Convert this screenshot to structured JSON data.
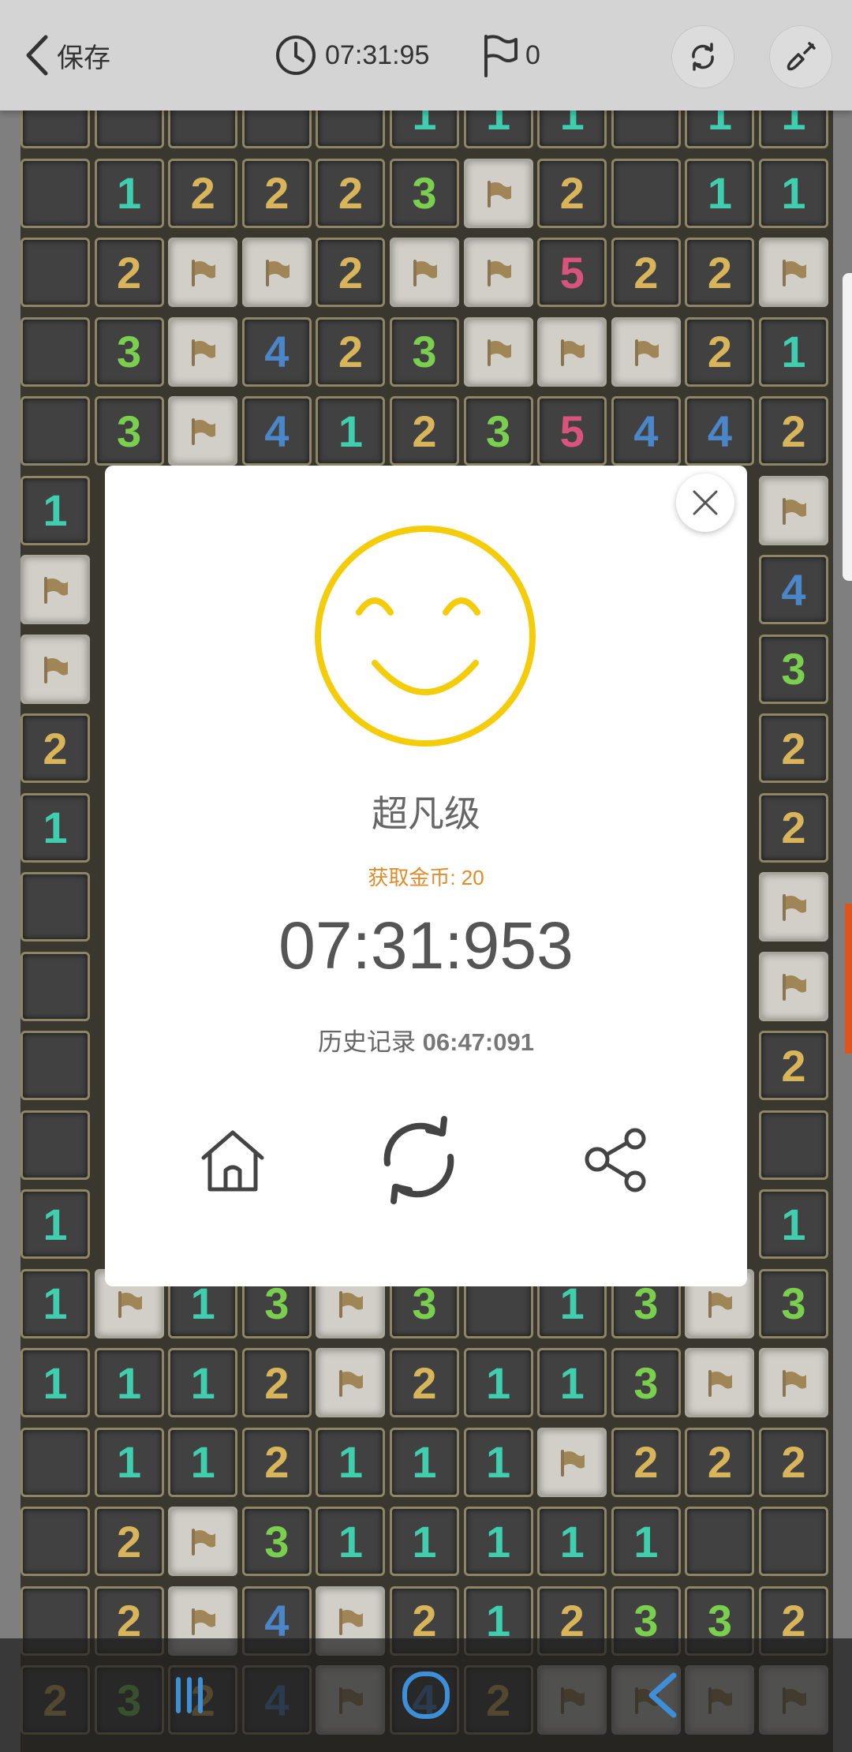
{
  "header": {
    "back_label": "保存",
    "timer": "07:31:95",
    "flag_count": "0"
  },
  "board": {
    "rows": [
      [
        "o",
        "o",
        "o",
        "o",
        "o",
        "1",
        "1",
        "1",
        "o",
        "1",
        "1"
      ],
      [
        "o",
        "1",
        "2",
        "2",
        "2",
        "3",
        "F",
        "2",
        "o",
        "1",
        "1"
      ],
      [
        "o",
        "2",
        "F",
        "F",
        "2",
        "F",
        "F",
        "5",
        "2",
        "2",
        "F"
      ],
      [
        "o",
        "3",
        "F",
        "4",
        "2",
        "3",
        "F",
        "F",
        "F",
        "2",
        "1"
      ],
      [
        "o",
        "3",
        "F",
        "4",
        "1",
        "2",
        "3",
        "5",
        "4",
        "4",
        "2"
      ],
      [
        "1",
        "",
        "",
        "",
        "",
        "",
        "",
        "",
        "",
        "",
        "F"
      ],
      [
        "F",
        "",
        "",
        "",
        "",
        "",
        "",
        "",
        "",
        "",
        "4"
      ],
      [
        "F",
        "",
        "",
        "",
        "",
        "",
        "",
        "",
        "",
        "",
        "3"
      ],
      [
        "2",
        "",
        "",
        "",
        "",
        "",
        "",
        "",
        "",
        "",
        "2"
      ],
      [
        "1",
        "",
        "",
        "",
        "",
        "",
        "",
        "",
        "",
        "",
        "2"
      ],
      [
        "o",
        "",
        "",
        "",
        "",
        "",
        "",
        "",
        "",
        "",
        "F"
      ],
      [
        "o",
        "",
        "",
        "",
        "",
        "",
        "",
        "",
        "",
        "",
        "F"
      ],
      [
        "o",
        "",
        "",
        "",
        "",
        "",
        "",
        "",
        "",
        "",
        "2"
      ],
      [
        "o",
        "",
        "",
        "",
        "",
        "",
        "",
        "",
        "",
        "",
        "o"
      ],
      [
        "1",
        "",
        "",
        "",
        "",
        "",
        "",
        "",
        "",
        "",
        "1"
      ],
      [
        "1",
        "F",
        "1",
        "3",
        "F",
        "3",
        "o",
        "1",
        "3",
        "F",
        "3"
      ],
      [
        "1",
        "1",
        "1",
        "2",
        "F",
        "2",
        "1",
        "1",
        "3",
        "F",
        "F"
      ],
      [
        "o",
        "1",
        "1",
        "2",
        "1",
        "1",
        "1",
        "F",
        "2",
        "2",
        "2"
      ],
      [
        "o",
        "2",
        "F",
        "3",
        "1",
        "1",
        "1",
        "1",
        "1",
        "o",
        "o"
      ],
      [
        "o",
        "2",
        "F",
        "4",
        "F",
        "2",
        "1",
        "2",
        "3",
        "3",
        "2"
      ],
      [
        "2",
        "3",
        "2",
        "4",
        "F",
        "4",
        "2",
        "F",
        "F",
        "F",
        "F"
      ]
    ]
  },
  "dialog": {
    "rank": "超凡级",
    "coins": "获取金币: 20",
    "time": "07:31:953",
    "record_label": "历史记录",
    "record_value": "06:47:091"
  },
  "colors": {
    "smiley": "#f5cc0a",
    "coin_text": "#e08a2a",
    "num1": "#3fcfae",
    "num2": "#d8b55a",
    "num3": "#7ad04e",
    "num4": "#4a86c8",
    "num5": "#d8537e"
  },
  "icons": {
    "back": "chevron-left-icon",
    "timer": "clock-icon",
    "flag": "flag-icon",
    "restart": "refresh-icon",
    "tool": "shovel-icon",
    "close": "close-icon",
    "home": "home-icon",
    "replay": "replay-icon",
    "share": "share-icon"
  }
}
